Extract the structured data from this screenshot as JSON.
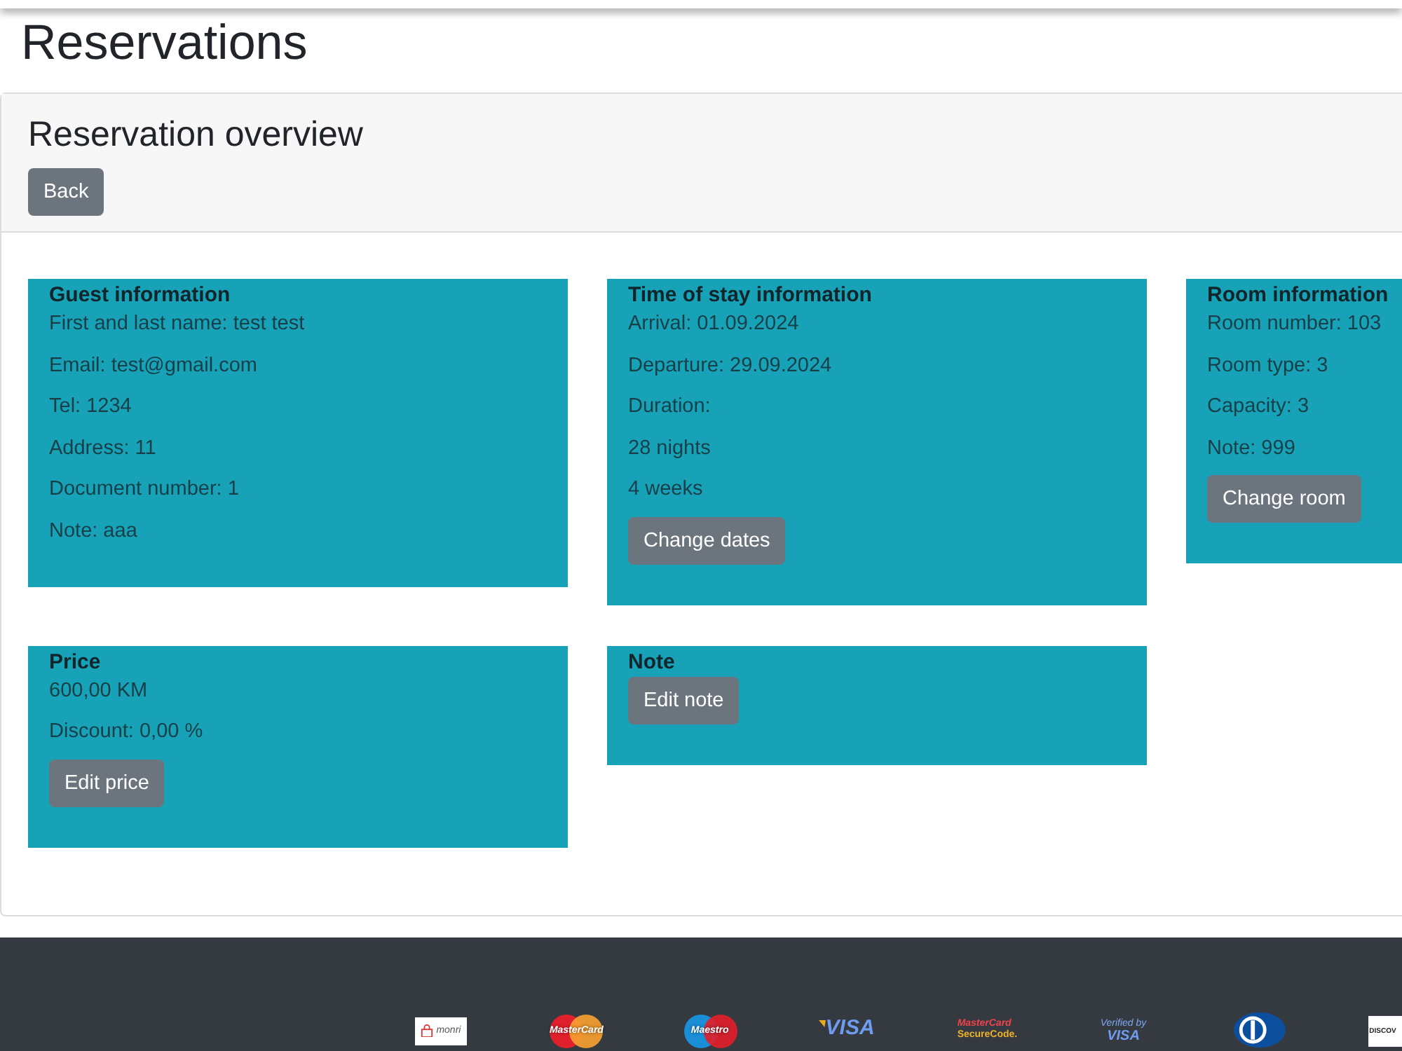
{
  "page": {
    "title": "Reservations"
  },
  "panel": {
    "title": "Reservation overview",
    "back_button": "Back"
  },
  "cards": [
    {
      "title": "Guest information",
      "lines": [
        "First and last name: test test",
        "Email: test@gmail.com",
        "Tel: 1234",
        "Address: 11",
        "Document number: 1",
        "Note: aaa"
      ]
    },
    {
      "title": "Time of stay information",
      "lines": [
        "Arrival: 01.09.2024",
        "Departure: 29.09.2024",
        "Duration:",
        "28 nights",
        "4 weeks"
      ],
      "button": "Change dates"
    },
    {
      "title": "Room information",
      "lines": [
        "Room number: 103",
        "Room type: 3",
        "Capacity: 3",
        "Note: 999"
      ],
      "button": "Change room"
    },
    {
      "title": "Price",
      "lines": [
        "600,00 KM",
        "Discount: 0,00 %"
      ],
      "button": "Edit price"
    },
    {
      "title": "Note",
      "button": "Edit note"
    }
  ],
  "footer": {
    "payment_logos": [
      {
        "kind": "tile",
        "lines": [
          "monri"
        ]
      },
      {
        "kind": "mastercard",
        "lines": [
          "MasterCard"
        ]
      },
      {
        "kind": "maestro",
        "lines": [
          "Maestro"
        ]
      },
      {
        "kind": "visa",
        "lines": [
          "VISA"
        ]
      },
      {
        "kind": "securecode",
        "lines": [
          "MasterCard",
          "SecureCode."
        ]
      },
      {
        "kind": "verified",
        "lines": [
          "Verified by",
          "VISA"
        ]
      },
      {
        "kind": "diners"
      },
      {
        "kind": "discover",
        "lines": [
          "DISCOV"
        ]
      }
    ]
  }
}
